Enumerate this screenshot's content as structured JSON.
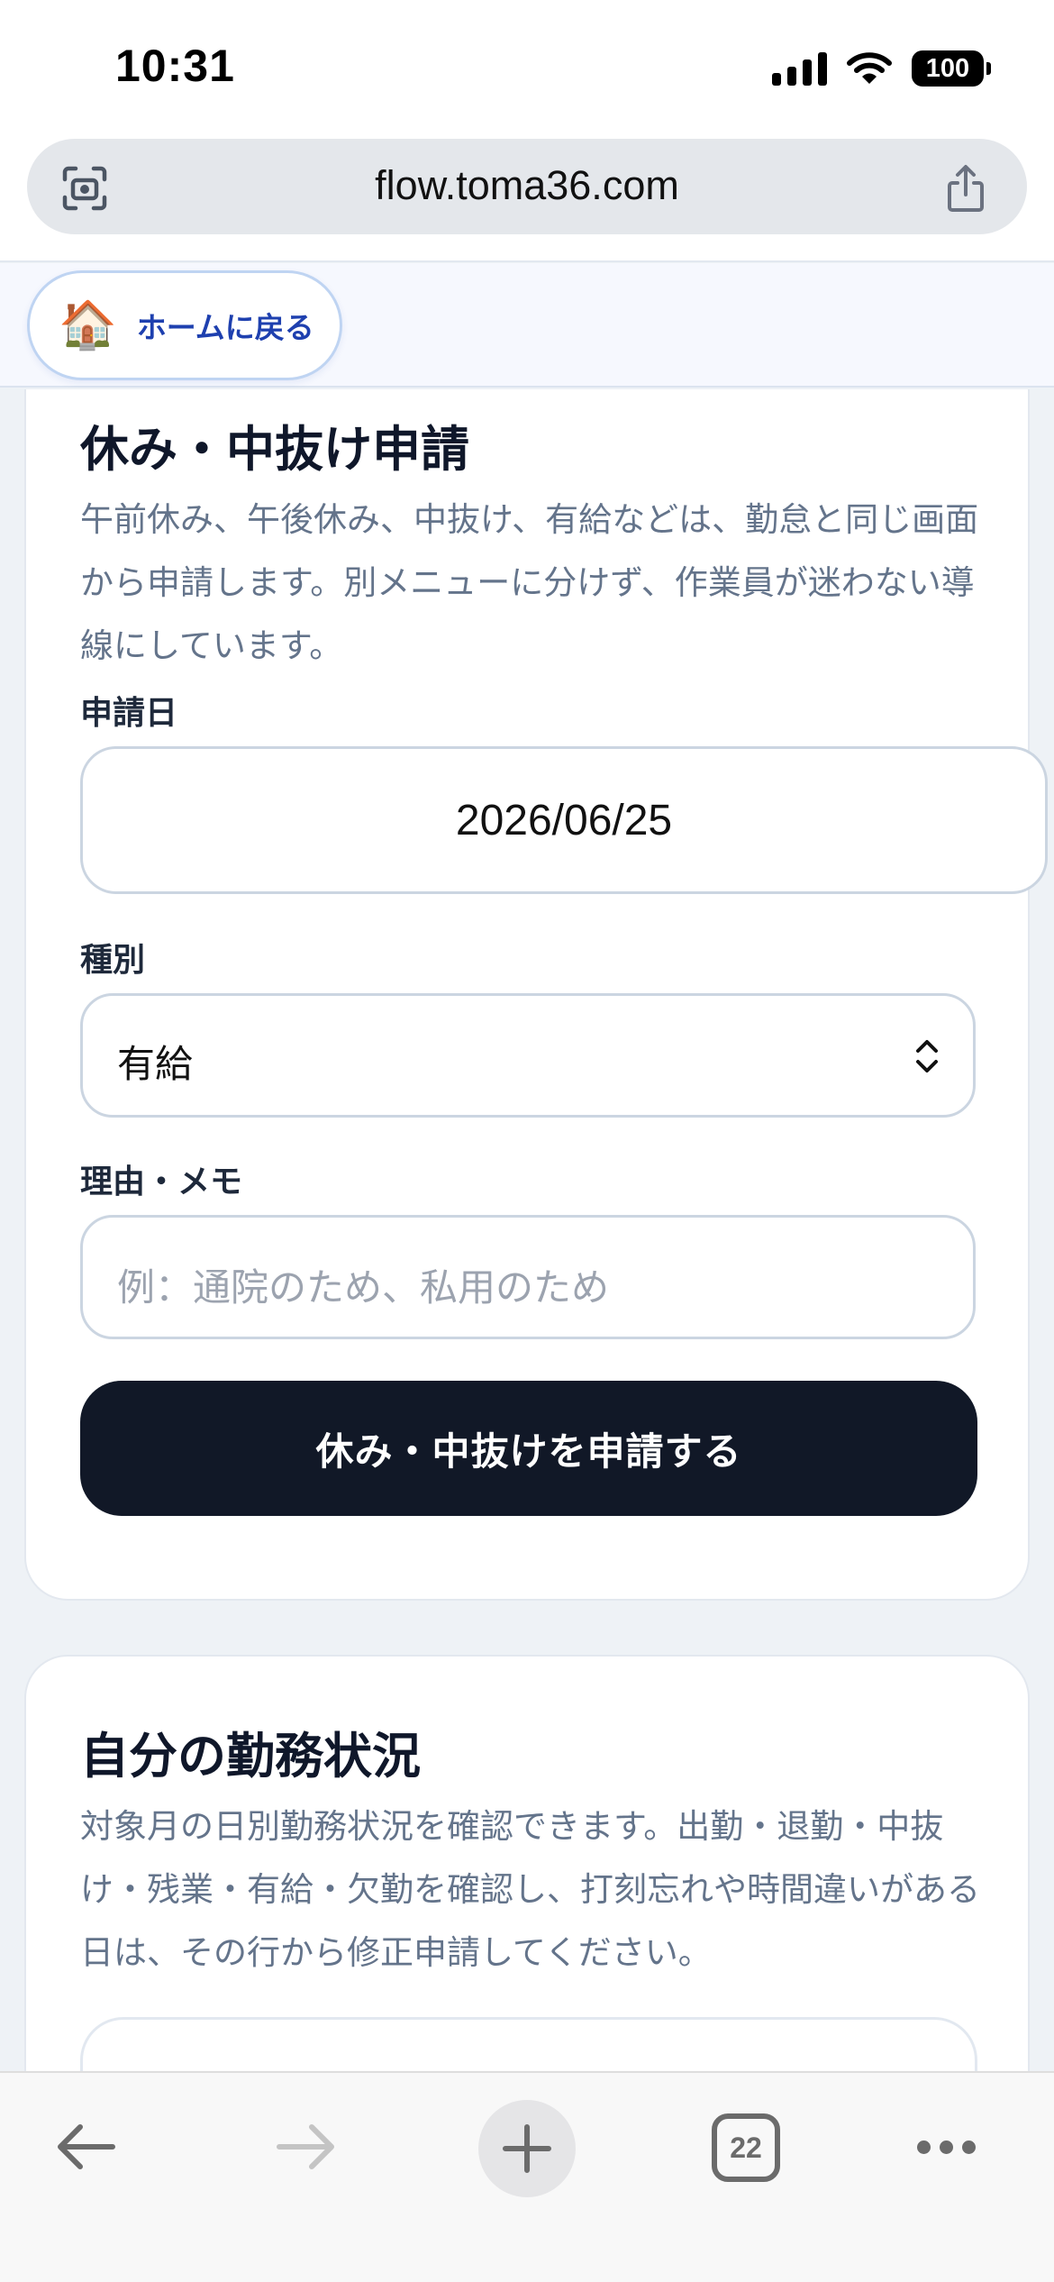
{
  "status_bar": {
    "time": "10:31",
    "battery": "100"
  },
  "browser": {
    "url": "flow.toma36.com",
    "tab_count": "22",
    "icons": {
      "lens": "camera-search-icon",
      "share": "share-icon",
      "back": "back-arrow-icon",
      "forward": "forward-arrow-icon",
      "new_tab": "plus-icon",
      "tabs": "tabs-icon",
      "more": "more-icon"
    }
  },
  "home": {
    "emoji": "🏠",
    "label": "ホームに戻る"
  },
  "leave_form": {
    "title": "休み・中抜け申請",
    "description": "午前休み、午後休み、中抜け、有給などは、勤怠と同じ画面から申請します。別メニューに分けず、作業員が迷わない導線にしています。",
    "date_label": "申請日",
    "date_value": "2026/06/25",
    "type_label": "種別",
    "type_value": "有給",
    "memo_label": "理由・メモ",
    "memo_placeholder": "例：通院のため、私用のため",
    "submit_label": "休み・中抜けを申請する"
  },
  "work_status": {
    "title": "自分の勤務状況",
    "description": "対象月の日別勤務状況を確認できます。出勤・退勤・中抜け・残業・有給・欠勤を確認し、打刻忘れや時間違いがある日は、その行から修正申請してください。"
  },
  "colors": {
    "primary_button": "#111827",
    "home_link": "#1e40af",
    "page_background": "#eef2f6",
    "muted_text": "#64748b"
  }
}
